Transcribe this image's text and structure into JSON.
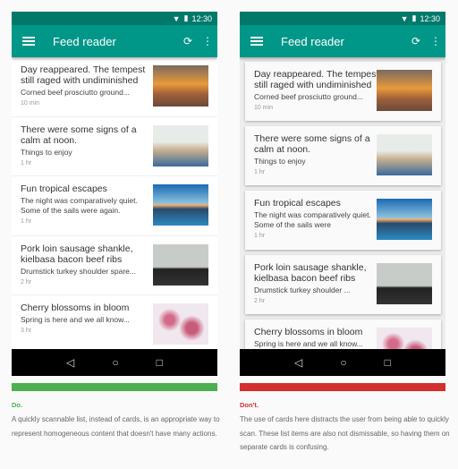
{
  "status": {
    "time": "12:30"
  },
  "app": {
    "title": "Feed reader",
    "menu_icon": "menu-icon",
    "refresh_icon": "refresh-icon",
    "more_icon": "more-vert-icon"
  },
  "items": [
    {
      "title": "Day reappeared. The tempest still raged with undiminished",
      "subtitle": "Corned beef prosciutto ground...",
      "time": "10 min",
      "image": "city-skyline-sunset"
    },
    {
      "title": "There were some signs of a calm at noon.",
      "subtitle": "Things to enjoy",
      "time": "1 hr",
      "image": "family-beach"
    },
    {
      "title": "Fun tropical escapes",
      "subtitle": "The night was comparatively quiet. Some of the sails were again.",
      "time": "1 hr",
      "image": "tropical-lake"
    },
    {
      "title": "Pork loin sausage shankle, kielbasa bacon beef ribs",
      "subtitle": "Drumstick turkey shoulder spare...",
      "time": "2 hr",
      "image": "man-portrait"
    },
    {
      "title": "Cherry blossoms in bloom",
      "subtitle": "Spring is here and we all know...",
      "time": "3 hr",
      "image": "cherry-blossoms"
    }
  ],
  "items_cards_subtitles": [
    "Corned beef prosciutto ground...",
    "Things to enjoy",
    "The night was comparatively quiet. Some of the sails were",
    "Drumstick turkey shoulder ...",
    "Spring is here and we all know..."
  ],
  "do": {
    "label": "Do.",
    "color": "#4caf50",
    "text": "A quickly scannable list, instead of cards, is an appropriate way to represent homogeneous content that doesn't have many actions."
  },
  "dont": {
    "label": "Don't.",
    "color": "#d32f2f",
    "text": "The use of cards here distracts the user from being able to quickly scan. These list items are also not dismissable, so having them on separate cards is confusing."
  }
}
